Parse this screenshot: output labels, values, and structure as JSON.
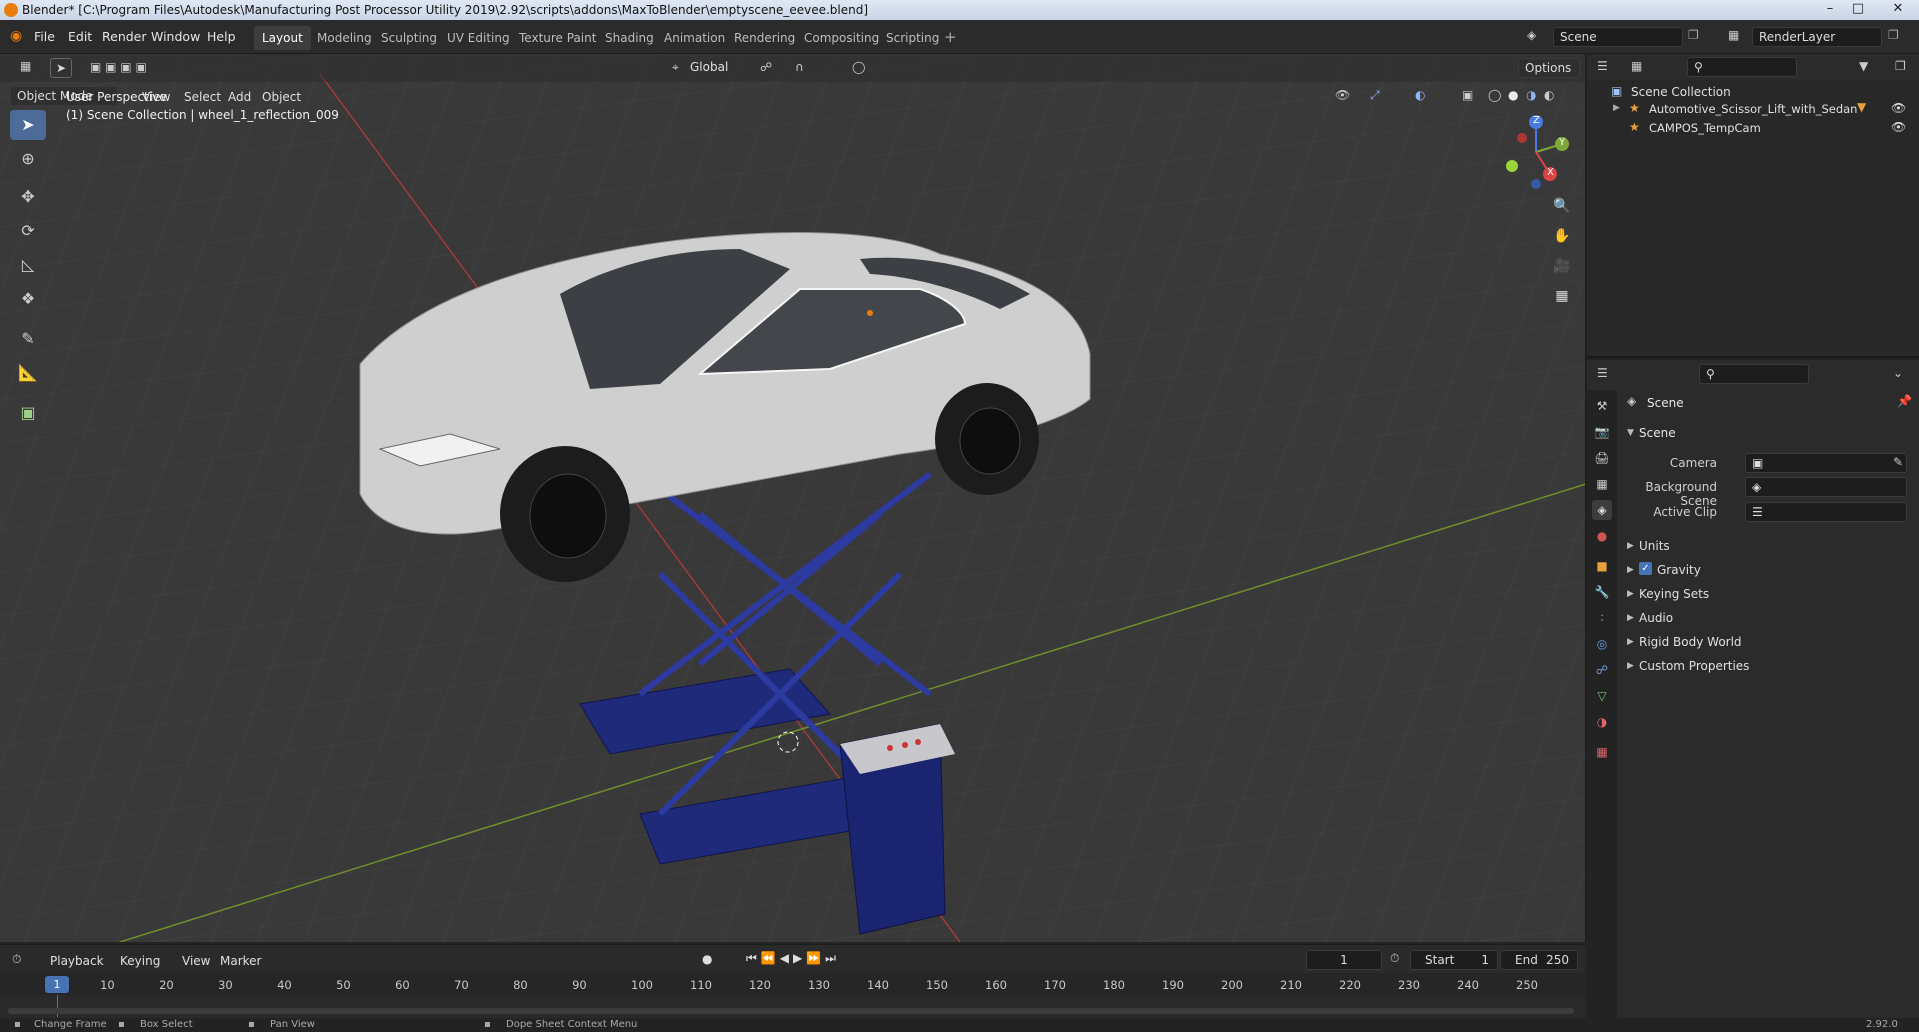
{
  "window": {
    "title": "Blender* [C:\\Program Files\\Autodesk\\Manufacturing Post Processor Utility 2019\\2.92\\scripts\\addons\\MaxToBlender\\emptyscene_eevee.blend]"
  },
  "menu": [
    "File",
    "Edit",
    "Render",
    "Window",
    "Help"
  ],
  "workspaces": [
    "Layout",
    "Modeling",
    "Sculpting",
    "UV Editing",
    "Texture Paint",
    "Shading",
    "Animation",
    "Rendering",
    "Compositing",
    "Scripting"
  ],
  "top_right": {
    "scene": "Scene",
    "render_layer": "RenderLayer"
  },
  "tool_header": {
    "orientation": "Global",
    "options": "Options"
  },
  "viewport_header": {
    "mode": "Object Mode",
    "items": [
      "View",
      "Select",
      "Add",
      "Object"
    ]
  },
  "viewport": {
    "perspective": "User Perspective",
    "context": "(1) Scene Collection | wheel_1_reflection_009",
    "gizmo": {
      "x": "X",
      "y": "Y",
      "z": "Z"
    },
    "colors": {
      "lift": "#1f2a7a",
      "car": "#cfcfcf",
      "grid_red": "#a23a3a",
      "grid_green": "#6f8f2d"
    }
  },
  "outliner": {
    "root": "Scene Collection",
    "items": [
      "Automotive_Scissor_Lift_with_Sedan",
      "CAMPOS_TempCam"
    ]
  },
  "properties": {
    "header": "Scene",
    "panel": "Scene",
    "fields": [
      {
        "label": "Camera"
      },
      {
        "label": "Background Scene"
      },
      {
        "label": "Active Clip"
      }
    ],
    "sections": [
      "Units",
      "Gravity",
      "Keying Sets",
      "Audio",
      "Rigid Body World",
      "Custom Properties"
    ],
    "gravity_checked": true
  },
  "timeline": {
    "menus": [
      "Playback",
      "Keying",
      "View",
      "Marker"
    ],
    "current_frame": "1",
    "start_label": "Start",
    "start": "1",
    "end_label": "End",
    "end": "250",
    "ticks": [
      "1",
      "10",
      "20",
      "30",
      "40",
      "50",
      "60",
      "70",
      "80",
      "90",
      "100",
      "110",
      "120",
      "130",
      "140",
      "150",
      "160",
      "170",
      "180",
      "190",
      "200",
      "210",
      "220",
      "230",
      "240",
      "250"
    ]
  },
  "statusbar": {
    "items": [
      "Change Frame",
      "Box Select",
      "Pan View",
      "Dope Sheet Context Menu"
    ],
    "version": "2.92.0"
  }
}
